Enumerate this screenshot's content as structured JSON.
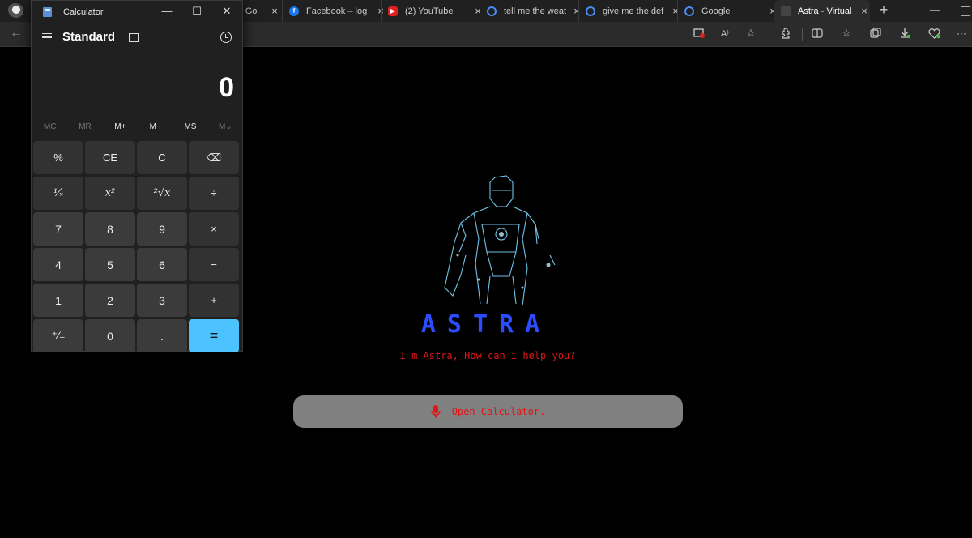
{
  "browser": {
    "tabs": [
      {
        "title": "- Go",
        "favicon": "google-icon"
      },
      {
        "title": "Facebook – log",
        "favicon": "facebook-icon"
      },
      {
        "title": "(2) YouTube",
        "favicon": "youtube-icon"
      },
      {
        "title": "tell me the weat",
        "favicon": "google-icon"
      },
      {
        "title": "give me the def",
        "favicon": "google-icon"
      },
      {
        "title": "Google",
        "favicon": "google-icon"
      },
      {
        "title": "Astra - Virtual A",
        "favicon": "astra-icon"
      }
    ],
    "close_glyph": "×",
    "new_tab_glyph": "+",
    "minimize_glyph": "—",
    "back_glyph": "←",
    "read_aloud_label": "A⁾",
    "more_glyph": "···"
  },
  "calculator": {
    "window_title": "Calculator",
    "mode": "Standard",
    "display": "0",
    "minimize_glyph": "—",
    "maximize_glyph": "☐",
    "close_glyph": "✕",
    "memory": [
      "MC",
      "MR",
      "M+",
      "M−",
      "MS",
      "M⌄"
    ],
    "keys": [
      "%",
      "CE",
      "C",
      "⌫",
      "¹⁄ₓ",
      "x²",
      "²√x",
      "÷",
      "7",
      "8",
      "9",
      "×",
      "4",
      "5",
      "6",
      "−",
      "1",
      "2",
      "3",
      "+",
      "⁺⁄₋",
      "0",
      ".",
      "="
    ]
  },
  "page": {
    "brand": "ASTRA",
    "greeting": "I m Astra, How can i help you?",
    "voice_text": "Open Calculator.",
    "brand_color": "#2b4dff",
    "text_color": "#e01515"
  }
}
